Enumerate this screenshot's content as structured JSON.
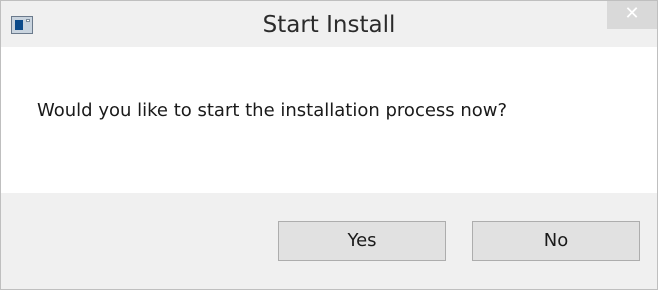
{
  "window": {
    "title": "Start Install",
    "icon": "app-window-icon",
    "close_label": "✕"
  },
  "dialog": {
    "message": "Would you like to start the installation process now?",
    "buttons": {
      "yes_label": "Yes",
      "no_label": "No"
    }
  },
  "colors": {
    "frame": "#f0f0f0",
    "content": "#ffffff",
    "button": "#e1e1e1",
    "close_button": "#d9d9d9"
  }
}
